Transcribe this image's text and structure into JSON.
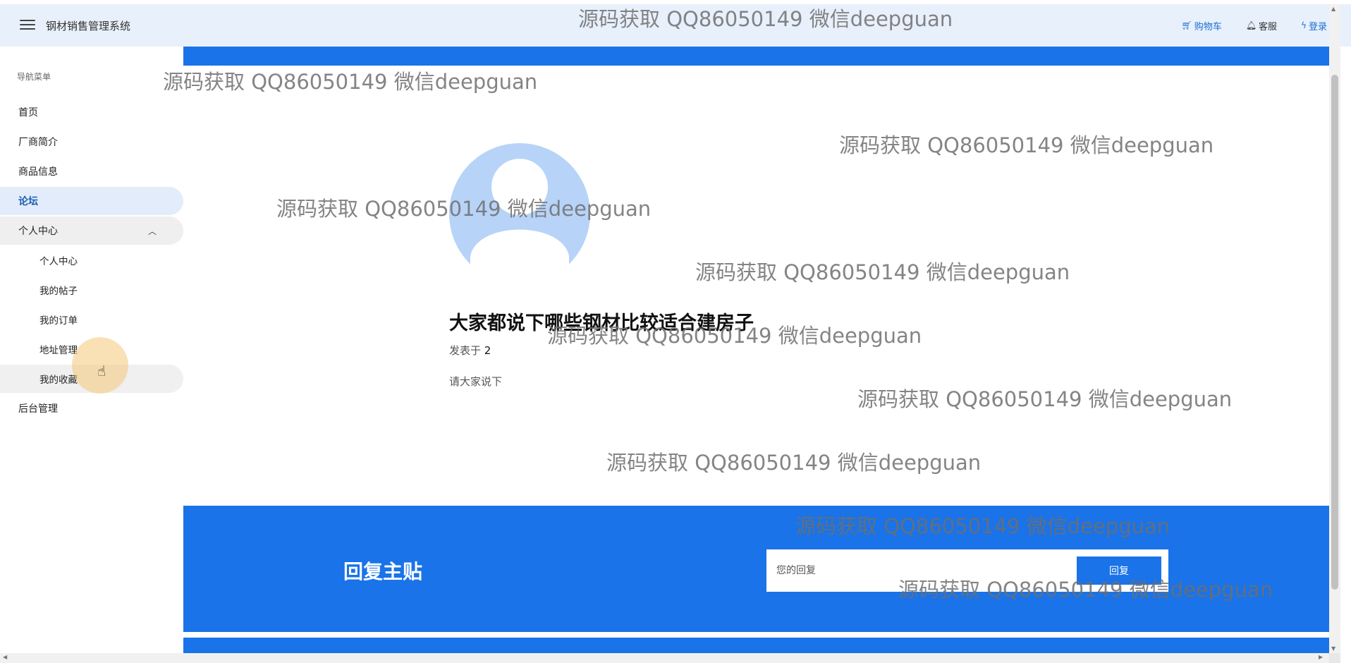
{
  "header": {
    "app_title": "钢材销售管理系统",
    "cart_label": "购物车",
    "service_label": "客服",
    "login_label": "登录",
    "icons": {
      "menu": "hamburger-icon",
      "cart": "cart-icon",
      "service": "bell-icon",
      "login": "lightning-icon"
    },
    "accent_color": "#1a6fd1"
  },
  "sidebar": {
    "section_label": "导航菜单",
    "items": [
      {
        "label": "首页"
      },
      {
        "label": "厂商简介"
      },
      {
        "label": "商品信息"
      },
      {
        "label": "论坛",
        "active": true
      },
      {
        "label": "个人中心",
        "expanded": true
      },
      {
        "label": "个人中心"
      },
      {
        "label": "我的帖子"
      },
      {
        "label": "我的订单"
      },
      {
        "label": "地址管理"
      },
      {
        "label": "我的收藏"
      },
      {
        "label": "后台管理"
      }
    ]
  },
  "post": {
    "title": "大家都说下哪些钢材比较适合建房子",
    "meta_prefix": "发表于",
    "meta_value": "2",
    "body": "请大家说下"
  },
  "reply": {
    "heading": "回复主贴",
    "placeholder": "您的回复",
    "button_label": "回复"
  },
  "watermark": {
    "text": "源码获取 QQ86050149 微信deepguan"
  },
  "colors": {
    "primary": "#1a73e8",
    "header_bg": "#e8f0fc",
    "avatar": "#b8d3f8"
  }
}
